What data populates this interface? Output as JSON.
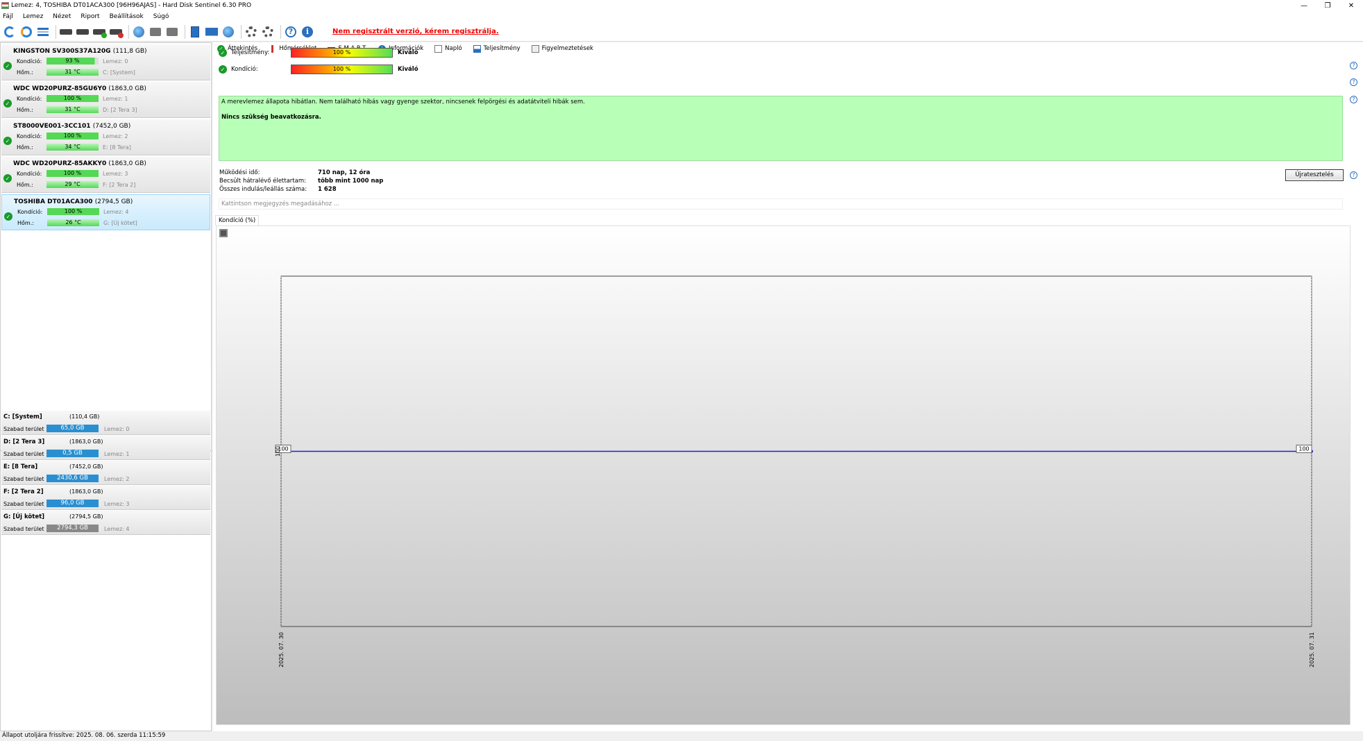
{
  "window": {
    "title": "Lemez: 4, TOSHIBA DT01ACA300 [96H96AJAS]  -  Hard Disk Sentinel 6.30 PRO",
    "buttons": [
      "—",
      "❐",
      "✕"
    ]
  },
  "menu": [
    "Fájl",
    "Lemez",
    "Nézet",
    "Riport",
    "Beállítások",
    "Súgó"
  ],
  "toolbar": {
    "register_msg": "Nem regisztrált verzió, kérem regisztrálja."
  },
  "disks": [
    {
      "name": "KINGSTON SV300S37A120G",
      "size": "(111,8 GB)",
      "cond_label": "Kondíció:",
      "cond": "93 %",
      "cond_pct": 93,
      "temp_label": "Hőm.:",
      "temp": "31 °C",
      "disk": "Lemez: 0",
      "vol": "C: [System]",
      "selected": false
    },
    {
      "name": "WDC WD20PURZ-85GU6Y0",
      "size": "(1863,0 GB)",
      "cond_label": "Kondíció:",
      "cond": "100 %",
      "cond_pct": 100,
      "temp_label": "Hőm.:",
      "temp": "31 °C",
      "disk": "Lemez: 1",
      "vol": "D: [2 Tera 3]",
      "selected": false
    },
    {
      "name": "ST8000VE001-3CC101",
      "size": "(7452,0 GB)",
      "cond_label": "Kondíció:",
      "cond": "100 %",
      "cond_pct": 100,
      "temp_label": "Hőm.:",
      "temp": "34 °C",
      "disk": "Lemez: 2",
      "vol": "E: [8 Tera]",
      "selected": false
    },
    {
      "name": "WDC WD20PURZ-85AKKY0",
      "size": "(1863,0 GB)",
      "cond_label": "Kondíció:",
      "cond": "100 %",
      "cond_pct": 100,
      "temp_label": "Hőm.:",
      "temp": "29 °C",
      "disk": "Lemez: 3",
      "vol": "F: [2 Tera 2]",
      "selected": false
    },
    {
      "name": "TOSHIBA DT01ACA300",
      "size": "(2794,5 GB)",
      "cond_label": "Kondíció:",
      "cond": "100 %",
      "cond_pct": 100,
      "temp_label": "Hőm.:",
      "temp": "26 °C",
      "disk": "Lemez: 4",
      "vol": "G: [Új kötet]",
      "selected": true
    }
  ],
  "volumes": [
    {
      "name": "C: [System]",
      "size": "(110,4 GB)",
      "free_label": "Szabad terület",
      "free": "65,0 GB",
      "color": "#2a8fd0",
      "disk": "Lemez: 0"
    },
    {
      "name": "D: [2 Tera 3]",
      "size": "(1863,0 GB)",
      "free_label": "Szabad terület",
      "free": "0,5 GB",
      "color": "#2a8fd0",
      "disk": "Lemez: 1"
    },
    {
      "name": "E: [8 Tera]",
      "size": "(7452,0 GB)",
      "free_label": "Szabad terület",
      "free": "2430,6 GB",
      "color": "#2a8fd0",
      "disk": "Lemez: 2"
    },
    {
      "name": "F: [2 Tera 2]",
      "size": "(1863,0 GB)",
      "free_label": "Szabad terület",
      "free": "96,0 GB",
      "color": "#2a8fd0",
      "disk": "Lemez: 3"
    },
    {
      "name": "G: [Új kötet]",
      "size": "(2794,5 GB)",
      "free_label": "Szabad terület",
      "free": "2794,3 GB",
      "color": "#888888",
      "disk": "Lemez: 4"
    }
  ],
  "tabs": [
    "Áttekintés",
    "Hőmérséklet",
    "S.M.A.R.T.",
    "Információk",
    "Napló",
    "Teljesítmény",
    "Figyelmeztetések"
  ],
  "summary": {
    "performance": {
      "label": "Teljesítmény:",
      "value": "100 %",
      "rating": "Kiváló"
    },
    "condition": {
      "label": "Kondíció:",
      "value": "100 %",
      "rating": "Kiváló"
    },
    "status_text": "A merevlemez állapota hibátlan. Nem található hibás vagy gyenge szektor, nincsenek felpörgési és adatátviteli hibák sem.",
    "status_action": "Nincs szükség beavatkozásra."
  },
  "info": {
    "uptime_label": "Működési idő:",
    "uptime": "710 nap, 12 óra",
    "remaining_label": "Becsült hátralévő élettartam:",
    "remaining": "több mint 1000 nap",
    "startstop_label": "Összes indulás/leállás száma:",
    "startstop": "1 628"
  },
  "retest_label": "Újratesztelés",
  "note_placeholder": "Kattintson megjegyzés megadásához ...",
  "chart_tab": "Kondíció  (%)",
  "chart_data": {
    "type": "line",
    "x": [
      "2025. 07. 30",
      "2025. 07. 31"
    ],
    "series": [
      {
        "values": [
          100,
          100
        ]
      }
    ],
    "point_labels": [
      "100",
      "100"
    ],
    "ytick": "100",
    "color": "#2020d0",
    "grid": false
  },
  "statusbar": "Állapot utoljára frissítve: 2025. 08. 06. szerda 11:15:59"
}
